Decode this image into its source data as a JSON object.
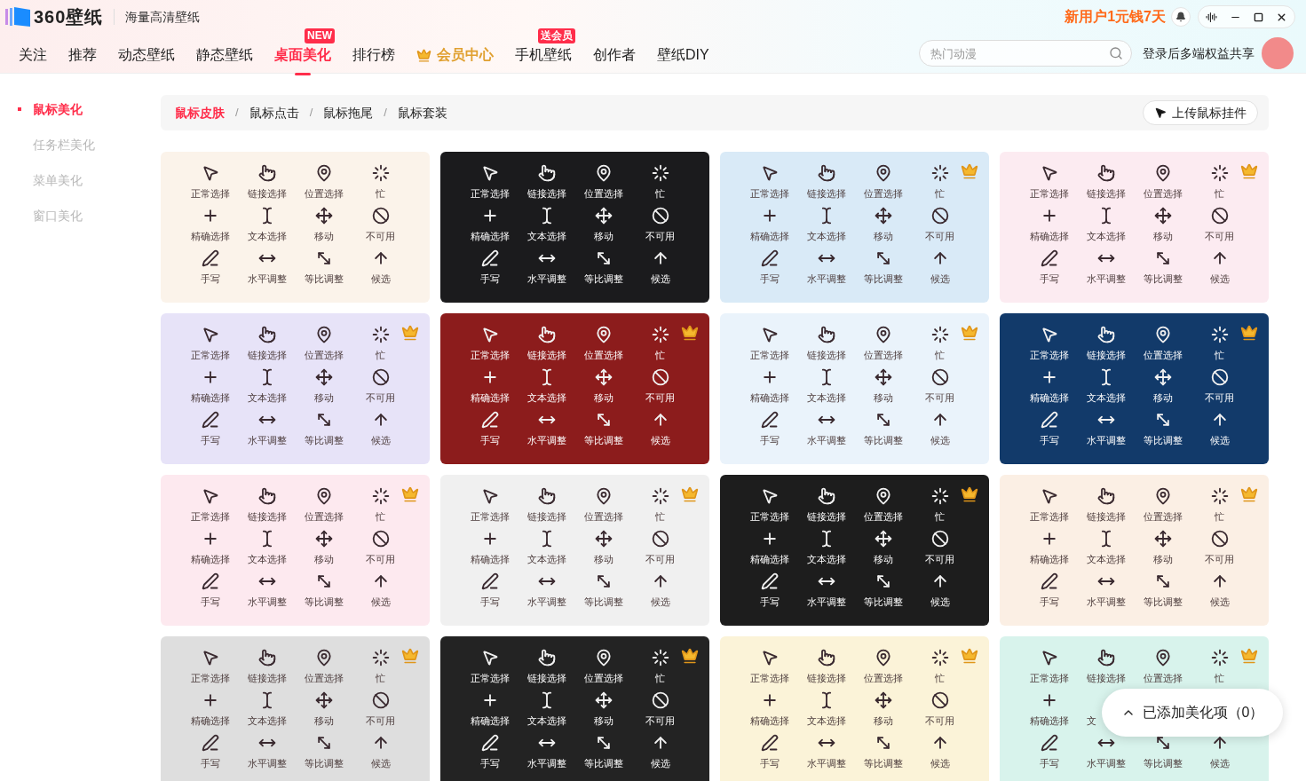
{
  "header": {
    "logo": "360壁纸",
    "tagline": "海量高清壁纸",
    "promo": "新用户1元钱7天",
    "nav": [
      {
        "label": "关注",
        "selected": false,
        "kind": "plain"
      },
      {
        "label": "推荐",
        "selected": false,
        "kind": "plain"
      },
      {
        "label": "动态壁纸",
        "selected": false,
        "kind": "plain"
      },
      {
        "label": "静态壁纸",
        "selected": false,
        "kind": "plain"
      },
      {
        "label": "桌面美化",
        "selected": true,
        "kind": "plain",
        "badge": "NEW"
      },
      {
        "label": "排行榜",
        "selected": false,
        "kind": "plain"
      },
      {
        "label": "会员中心",
        "selected": false,
        "kind": "vip"
      },
      {
        "label": "手机壁纸",
        "selected": false,
        "kind": "plain",
        "badge": "送会员"
      },
      {
        "label": "创作者",
        "selected": false,
        "kind": "plain"
      },
      {
        "label": "壁纸DIY",
        "selected": false,
        "kind": "plain"
      }
    ],
    "search": {
      "placeholder": "热门动漫"
    },
    "login": "登录后多端权益共享"
  },
  "sidebar": {
    "items": [
      {
        "label": "鼠标美化",
        "selected": true
      },
      {
        "label": "任务栏美化",
        "selected": false
      },
      {
        "label": "菜单美化",
        "selected": false
      },
      {
        "label": "窗口美化",
        "selected": false
      }
    ]
  },
  "breadcrumb": {
    "items": [
      {
        "label": "鼠标皮肤",
        "selected": true
      },
      {
        "label": "鼠标点击",
        "selected": false
      },
      {
        "label": "鼠标拖尾",
        "selected": false
      },
      {
        "label": "鼠标套装",
        "selected": false
      }
    ],
    "separators": [
      "/",
      "/",
      "/"
    ],
    "upload_button": "上传鼠标挂件"
  },
  "cards": [
    {
      "color": "#fbf3ea",
      "kind": "light",
      "vip": false,
      "rows": [
        [
          "正常选择",
          "链接选择",
          "位置选择",
          "忙"
        ],
        [
          "精确选择",
          "文本选择",
          "移动",
          "不可用"
        ],
        [
          "手写",
          "水平调整",
          "等比调整",
          "候选"
        ]
      ]
    },
    {
      "color": "#1b1b1d",
      "kind": "dark",
      "vip": false,
      "rows": [
        [
          "正常选择",
          "链接选择",
          "位置选择",
          "忙"
        ],
        [
          "精确选择",
          "文本选择",
          "移动",
          "不可用"
        ],
        [
          "手写",
          "水平调整",
          "等比调整",
          "候选"
        ]
      ]
    },
    {
      "color": "#d9eaf7",
      "kind": "light",
      "vip": true,
      "rows": [
        [
          "正常选择",
          "链接选择",
          "位置选择",
          "忙"
        ],
        [
          "精确选择",
          "文本选择",
          "移动",
          "不可用"
        ],
        [
          "手写",
          "水平调整",
          "等比调整",
          "候选"
        ]
      ]
    },
    {
      "color": "#fcebf1",
      "kind": "light",
      "vip": true,
      "rows": [
        [
          "正常选择",
          "链接选择",
          "位置选择",
          "忙"
        ],
        [
          "精确选择",
          "文本选择",
          "移动",
          "不可用"
        ],
        [
          "手写",
          "水平调整",
          "等比调整",
          "候选"
        ]
      ]
    },
    {
      "color": "#e7e3f8",
      "kind": "light",
      "vip": true,
      "rows": [
        [
          "正常选择",
          "链接选择",
          "位置选择",
          "忙"
        ],
        [
          "精确选择",
          "文本选择",
          "移动",
          "不可用"
        ],
        [
          "手写",
          "水平调整",
          "等比调整",
          "候选"
        ]
      ]
    },
    {
      "color": "#8c1c1c",
      "kind": "dark",
      "vip": true,
      "rows": [
        [
          "正常选择",
          "链接选择",
          "位置选择",
          "忙"
        ],
        [
          "精确选择",
          "文本选择",
          "移动",
          "不可用"
        ],
        [
          "手写",
          "水平调整",
          "等比调整",
          "候选"
        ]
      ]
    },
    {
      "color": "#eaf3fb",
      "kind": "light",
      "vip": true,
      "rows": [
        [
          "正常选择",
          "链接选择",
          "位置选择",
          "忙"
        ],
        [
          "精确选择",
          "文本选择",
          "移动",
          "不可用"
        ],
        [
          "手写",
          "水平调整",
          "等比调整",
          "候选"
        ]
      ]
    },
    {
      "color": "#123a6a",
      "kind": "dark",
      "vip": true,
      "rows": [
        [
          "正常选择",
          "链接选择",
          "位置选择",
          "忙"
        ],
        [
          "精确选择",
          "文本选择",
          "移动",
          "不可用"
        ],
        [
          "手写",
          "水平调整",
          "等比调整",
          "候选"
        ]
      ]
    },
    {
      "color": "#fde9ef",
      "kind": "light",
      "vip": true,
      "rows": [
        [
          "正常选择",
          "链接选择",
          "位置选择",
          "忙"
        ],
        [
          "精确选择",
          "文本选择",
          "移动",
          "不可用"
        ],
        [
          "手写",
          "水平调整",
          "等比调整",
          "候选"
        ]
      ]
    },
    {
      "color": "#f0f0f0",
      "kind": "light",
      "vip": true,
      "rows": [
        [
          "正常选择",
          "链接选择",
          "位置选择",
          "忙"
        ],
        [
          "精确选择",
          "文本选择",
          "移动",
          "不可用"
        ],
        [
          "手写",
          "水平调整",
          "等比调整",
          "候选"
        ]
      ]
    },
    {
      "color": "#1d1d1d",
      "kind": "dark",
      "vip": true,
      "rows": [
        [
          "正常选择",
          "链接选择",
          "位置选择",
          "忙"
        ],
        [
          "精确选择",
          "文本选择",
          "移动",
          "不可用"
        ],
        [
          "手写",
          "水平调整",
          "等比调整",
          "候选"
        ]
      ]
    },
    {
      "color": "#fbefe4",
      "kind": "light",
      "vip": true,
      "rows": [
        [
          "正常选择",
          "链接选择",
          "位置选择",
          "忙"
        ],
        [
          "精确选择",
          "文本选择",
          "移动",
          "不可用"
        ],
        [
          "手写",
          "水平调整",
          "等比调整",
          "候选"
        ]
      ]
    },
    {
      "color": "#dedede",
      "kind": "light",
      "vip": true,
      "rows": [
        [
          "正常选择",
          "链接选择",
          "位置选择",
          "忙"
        ],
        [
          "精确选择",
          "文本选择",
          "移动",
          "不可用"
        ],
        [
          "手写",
          "水平调整",
          "等比调整",
          "候选"
        ]
      ]
    },
    {
      "color": "#232323",
      "kind": "dark",
      "vip": true,
      "rows": [
        [
          "正常选择",
          "链接选择",
          "位置选择",
          "忙"
        ],
        [
          "精确选择",
          "文本选择",
          "移动",
          "不可用"
        ],
        [
          "手写",
          "水平调整",
          "等比调整",
          "候选"
        ]
      ]
    },
    {
      "color": "#fbf3d8",
      "kind": "light",
      "vip": true,
      "rows": [
        [
          "正常选择",
          "链接选择",
          "位置选择",
          "忙"
        ],
        [
          "精确选择",
          "文本选择",
          "移动",
          "不可用"
        ],
        [
          "手写",
          "水平调整",
          "等比调整",
          "候选"
        ]
      ]
    },
    {
      "color": "#d8f3ec",
      "kind": "light",
      "vip": true,
      "rows": [
        [
          "正常选择",
          "链接选择",
          "位置选择",
          "忙"
        ],
        [
          "精确选择",
          "文"
        ],
        [
          "手写",
          "水平调整",
          "等比调整",
          "候选"
        ]
      ]
    }
  ],
  "added_popup": {
    "label": "已添加美化项（0）"
  }
}
